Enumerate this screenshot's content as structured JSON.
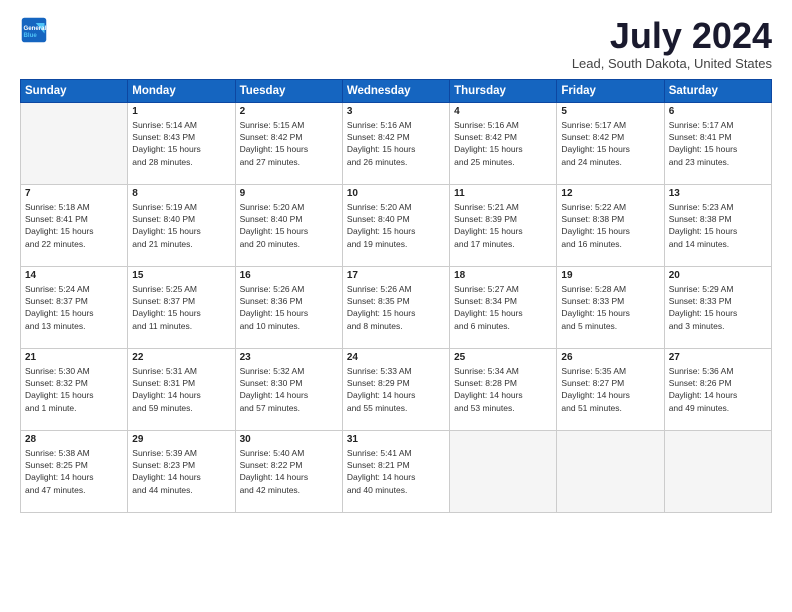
{
  "header": {
    "logo_line1": "General",
    "logo_line2": "Blue",
    "month_title": "July 2024",
    "location": "Lead, South Dakota, United States"
  },
  "weekdays": [
    "Sunday",
    "Monday",
    "Tuesday",
    "Wednesday",
    "Thursday",
    "Friday",
    "Saturday"
  ],
  "weeks": [
    [
      {
        "day": "",
        "info": ""
      },
      {
        "day": "1",
        "info": "Sunrise: 5:14 AM\nSunset: 8:43 PM\nDaylight: 15 hours\nand 28 minutes."
      },
      {
        "day": "2",
        "info": "Sunrise: 5:15 AM\nSunset: 8:42 PM\nDaylight: 15 hours\nand 27 minutes."
      },
      {
        "day": "3",
        "info": "Sunrise: 5:16 AM\nSunset: 8:42 PM\nDaylight: 15 hours\nand 26 minutes."
      },
      {
        "day": "4",
        "info": "Sunrise: 5:16 AM\nSunset: 8:42 PM\nDaylight: 15 hours\nand 25 minutes."
      },
      {
        "day": "5",
        "info": "Sunrise: 5:17 AM\nSunset: 8:42 PM\nDaylight: 15 hours\nand 24 minutes."
      },
      {
        "day": "6",
        "info": "Sunrise: 5:17 AM\nSunset: 8:41 PM\nDaylight: 15 hours\nand 23 minutes."
      }
    ],
    [
      {
        "day": "7",
        "info": "Sunrise: 5:18 AM\nSunset: 8:41 PM\nDaylight: 15 hours\nand 22 minutes."
      },
      {
        "day": "8",
        "info": "Sunrise: 5:19 AM\nSunset: 8:40 PM\nDaylight: 15 hours\nand 21 minutes."
      },
      {
        "day": "9",
        "info": "Sunrise: 5:20 AM\nSunset: 8:40 PM\nDaylight: 15 hours\nand 20 minutes."
      },
      {
        "day": "10",
        "info": "Sunrise: 5:20 AM\nSunset: 8:40 PM\nDaylight: 15 hours\nand 19 minutes."
      },
      {
        "day": "11",
        "info": "Sunrise: 5:21 AM\nSunset: 8:39 PM\nDaylight: 15 hours\nand 17 minutes."
      },
      {
        "day": "12",
        "info": "Sunrise: 5:22 AM\nSunset: 8:38 PM\nDaylight: 15 hours\nand 16 minutes."
      },
      {
        "day": "13",
        "info": "Sunrise: 5:23 AM\nSunset: 8:38 PM\nDaylight: 15 hours\nand 14 minutes."
      }
    ],
    [
      {
        "day": "14",
        "info": "Sunrise: 5:24 AM\nSunset: 8:37 PM\nDaylight: 15 hours\nand 13 minutes."
      },
      {
        "day": "15",
        "info": "Sunrise: 5:25 AM\nSunset: 8:37 PM\nDaylight: 15 hours\nand 11 minutes."
      },
      {
        "day": "16",
        "info": "Sunrise: 5:26 AM\nSunset: 8:36 PM\nDaylight: 15 hours\nand 10 minutes."
      },
      {
        "day": "17",
        "info": "Sunrise: 5:26 AM\nSunset: 8:35 PM\nDaylight: 15 hours\nand 8 minutes."
      },
      {
        "day": "18",
        "info": "Sunrise: 5:27 AM\nSunset: 8:34 PM\nDaylight: 15 hours\nand 6 minutes."
      },
      {
        "day": "19",
        "info": "Sunrise: 5:28 AM\nSunset: 8:33 PM\nDaylight: 15 hours\nand 5 minutes."
      },
      {
        "day": "20",
        "info": "Sunrise: 5:29 AM\nSunset: 8:33 PM\nDaylight: 15 hours\nand 3 minutes."
      }
    ],
    [
      {
        "day": "21",
        "info": "Sunrise: 5:30 AM\nSunset: 8:32 PM\nDaylight: 15 hours\nand 1 minute."
      },
      {
        "day": "22",
        "info": "Sunrise: 5:31 AM\nSunset: 8:31 PM\nDaylight: 14 hours\nand 59 minutes."
      },
      {
        "day": "23",
        "info": "Sunrise: 5:32 AM\nSunset: 8:30 PM\nDaylight: 14 hours\nand 57 minutes."
      },
      {
        "day": "24",
        "info": "Sunrise: 5:33 AM\nSunset: 8:29 PM\nDaylight: 14 hours\nand 55 minutes."
      },
      {
        "day": "25",
        "info": "Sunrise: 5:34 AM\nSunset: 8:28 PM\nDaylight: 14 hours\nand 53 minutes."
      },
      {
        "day": "26",
        "info": "Sunrise: 5:35 AM\nSunset: 8:27 PM\nDaylight: 14 hours\nand 51 minutes."
      },
      {
        "day": "27",
        "info": "Sunrise: 5:36 AM\nSunset: 8:26 PM\nDaylight: 14 hours\nand 49 minutes."
      }
    ],
    [
      {
        "day": "28",
        "info": "Sunrise: 5:38 AM\nSunset: 8:25 PM\nDaylight: 14 hours\nand 47 minutes."
      },
      {
        "day": "29",
        "info": "Sunrise: 5:39 AM\nSunset: 8:23 PM\nDaylight: 14 hours\nand 44 minutes."
      },
      {
        "day": "30",
        "info": "Sunrise: 5:40 AM\nSunset: 8:22 PM\nDaylight: 14 hours\nand 42 minutes."
      },
      {
        "day": "31",
        "info": "Sunrise: 5:41 AM\nSunset: 8:21 PM\nDaylight: 14 hours\nand 40 minutes."
      },
      {
        "day": "",
        "info": ""
      },
      {
        "day": "",
        "info": ""
      },
      {
        "day": "",
        "info": ""
      }
    ]
  ]
}
